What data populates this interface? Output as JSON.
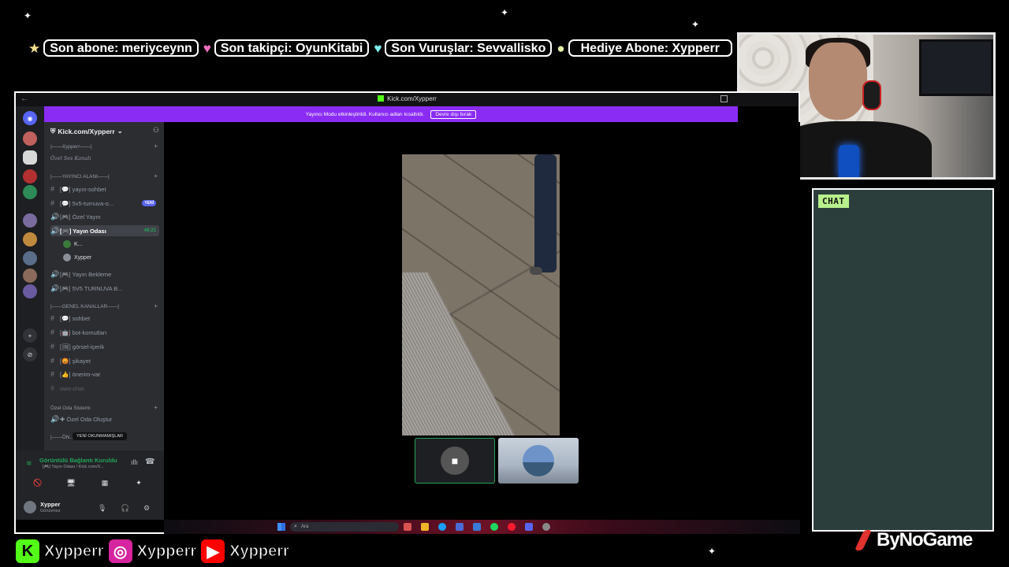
{
  "ticker": [
    {
      "icon": "★",
      "color": "#f5e08a",
      "text": "Son abone: meriyceynn",
      "cls": ""
    },
    {
      "icon": "♥",
      "color": "#f06fc0",
      "text": "Son takipçi: OyunKitabi",
      "cls": ""
    },
    {
      "icon": "♥",
      "color": "#7ff0ee",
      "text": "Son Vuruşlar: Sevvallisko",
      "cls": ""
    },
    {
      "icon": "●",
      "color": "#e8f0a8",
      "text": "Hediye Abone: Xypperr",
      "cls": "gift"
    }
  ],
  "chat": {
    "label": "CHAT"
  },
  "browser": {
    "title": "Kick.com/Xypperr",
    "back": "←"
  },
  "notice": {
    "text": "Yayıncı Modu etkinleştirildi. Kullanıcı adları kısaltıldı.",
    "button": "Devre dışı bırak"
  },
  "sidebar": {
    "server_name": "Kick.com/Xypperr",
    "categories": {
      "c1": "|——Xypperr——|",
      "c2": "Özel Ses Kanalı",
      "c3": "|——YAYINCI ALANI——|",
      "c4": "|——GENEL KANALLAR——|",
      "c5": "Özel Oda Sistemi",
      "c6": "|——ÖN..."
    },
    "channels": [
      {
        "sym": "#",
        "name": "[💬] yayın-sohbet"
      },
      {
        "sym": "#",
        "name": "[💬] 5v5-turnuva-o...",
        "badge": "YENİ"
      },
      {
        "sym": "🔊",
        "name": "[🎮] Özel Yayın"
      },
      {
        "sym": "🔊",
        "name": "[🎮] Yayın Odası",
        "time": "46:21"
      },
      {
        "sym": "🔊",
        "name": "[🎮] Yayın Bekleme"
      },
      {
        "sym": "🔊",
        "name": "[🎮] 5V5 TURNUVA B..."
      },
      {
        "sym": "#",
        "name": "[💬] sohbet"
      },
      {
        "sym": "#",
        "name": "[🤖] bot-komutları"
      },
      {
        "sym": "#",
        "name": "[🖼] görsel-içerik"
      },
      {
        "sym": "#",
        "name": "[😡] şikayet"
      },
      {
        "sym": "#",
        "name": "[👍] önerim-var"
      },
      {
        "sym": "#",
        "name": "owo-chat"
      },
      {
        "sym": "🔊",
        "name": "✚ Özel Oda Oluştur"
      }
    ],
    "voice_users": [
      "K...",
      "Xypper"
    ],
    "tooltip": "YENİ OKUNMAMIŞLAR"
  },
  "voice_panel": {
    "status": "Görüntülü Bağlantı Kuruldu",
    "sub": "[🎮] Yayın Odası / Kick.com/X...",
    "buttons": [
      "🚫",
      "🖥",
      "▦",
      "✦"
    ]
  },
  "user": {
    "name": "Xypper",
    "status": "Görünmez"
  },
  "taskbar": {
    "search": "Ara"
  },
  "socials": [
    {
      "icon": "K",
      "bg": "#53fc18",
      "fg": "#000",
      "name": "Xypperr"
    },
    {
      "icon": "◎",
      "bg": "#d6249f",
      "fg": "#fff",
      "name": "Xypperr"
    },
    {
      "icon": "▶",
      "bg": "#ff0000",
      "fg": "#fff",
      "name": "Xypperr"
    }
  ],
  "brand": "ByNoGame"
}
